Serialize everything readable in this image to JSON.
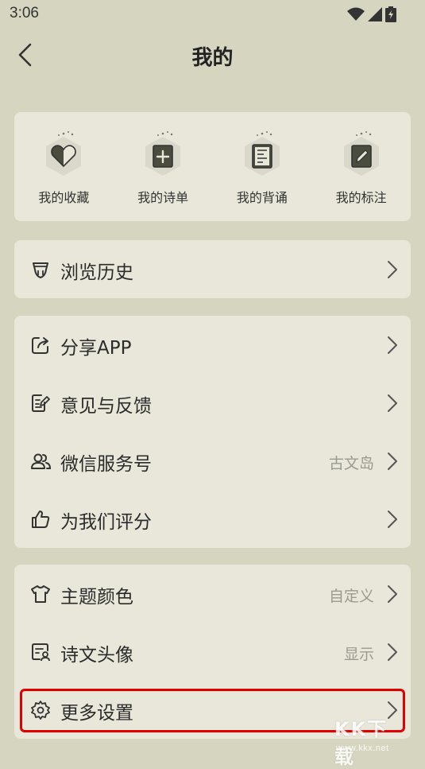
{
  "status_bar": {
    "time": "3:06"
  },
  "header": {
    "title": "我的"
  },
  "quick_actions": [
    {
      "label": "我的收藏",
      "icon": "heart-icon"
    },
    {
      "label": "我的诗单",
      "icon": "add-list-icon"
    },
    {
      "label": "我的背诵",
      "icon": "recite-icon"
    },
    {
      "label": "我的标注",
      "icon": "annotate-icon"
    }
  ],
  "history": {
    "label": "浏览历史",
    "icon": "history-icon"
  },
  "misc": {
    "share": {
      "label": "分享APP",
      "icon": "share-icon"
    },
    "feedback": {
      "label": "意见与反馈",
      "icon": "feedback-icon"
    },
    "wechat": {
      "label": "微信服务号",
      "value": "古文岛",
      "icon": "people-icon"
    },
    "rate": {
      "label": "为我们评分",
      "icon": "thumb-up-icon"
    }
  },
  "settings": {
    "theme": {
      "label": "主题颜色",
      "value": "自定义",
      "icon": "shirt-icon"
    },
    "avatar": {
      "label": "诗文头像",
      "value": "显示",
      "icon": "avatar-card-icon"
    },
    "more": {
      "label": "更多设置",
      "icon": "gear-icon"
    }
  },
  "watermark": {
    "text": "KK下载",
    "url": "www.kkx.net"
  },
  "colors": {
    "background": "#d6d5c0",
    "card": "#e8e7d9",
    "accent_dark": "#4a4d3d",
    "highlight": "#e00000"
  }
}
